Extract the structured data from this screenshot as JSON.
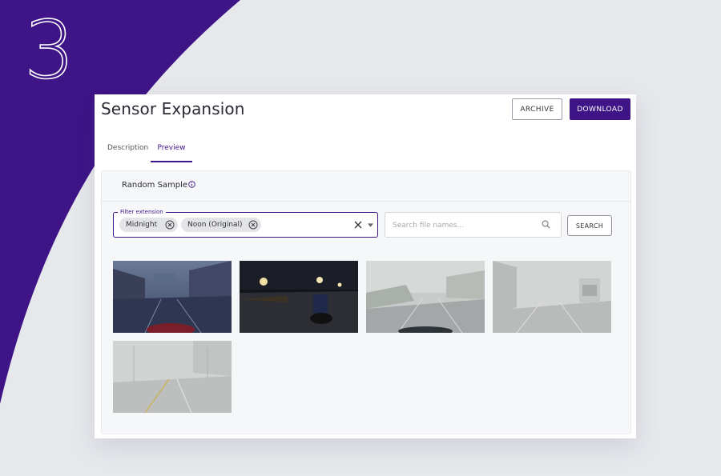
{
  "step": "3",
  "page_title": "Sensor Expansion",
  "header_buttons": {
    "archive": "ARCHIVE",
    "download": "DOWNLOAD"
  },
  "tabs": [
    {
      "label": "Description",
      "active": false
    },
    {
      "label": "Preview",
      "active": true
    }
  ],
  "panel": {
    "title": "Random Sample",
    "filter": {
      "legend": "Filter extension",
      "chips": [
        "Midnight",
        "Noon (Original)"
      ]
    },
    "search": {
      "placeholder": "Search file names...",
      "button": "SEARCH"
    }
  },
  "icons": {
    "info": "info-circle-icon",
    "chip_remove": "close-circle-icon",
    "clear": "close-icon",
    "dropdown": "caret-down-icon",
    "search": "search-icon"
  },
  "colors": {
    "brand_purple": "#3e1487",
    "page_background": "#e6e8ec",
    "panel_background": "#f6f7f9"
  }
}
